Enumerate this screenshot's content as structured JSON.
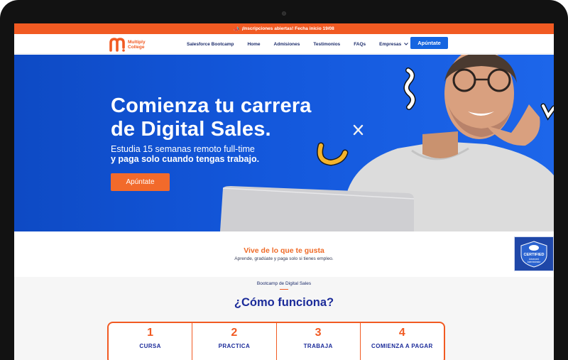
{
  "promo": {
    "text": "¡Inscripciones abiertas! Fecha inicio 19/08"
  },
  "brand": {
    "line1": "Multiply",
    "line2": "College",
    "color_orange": "#f15a22",
    "color_blue": "#1565e0",
    "color_navy": "#1c2c6b"
  },
  "nav": {
    "items": [
      {
        "label": "Salesforce Bootcamp"
      },
      {
        "label": "Home"
      },
      {
        "label": "Admisiones"
      },
      {
        "label": "Testimonios"
      },
      {
        "label": "FAQs"
      },
      {
        "label": "Empresas"
      }
    ],
    "cta": "Apúntate"
  },
  "hero": {
    "title_line1": "Comienza tu carrera",
    "title_line2": "de Digital Sales.",
    "subtitle_line1": "Estudia 15 semanas remoto full-time",
    "subtitle_line2": "y paga solo cuando tengas trabajo.",
    "button": "Apúntate"
  },
  "tagline": {
    "title": "Vive de lo que te gusta",
    "subtitle": "Aprende, gradúate y paga solo si tienes empleo."
  },
  "badge": {
    "title": "CERTIFIED",
    "line1": "Advanced",
    "line2": "Administrator"
  },
  "how": {
    "kicker": "Bootcamp de Digital Sales",
    "title": "¿Cómo funciona?",
    "steps": [
      {
        "number": "1",
        "label": "CURSA"
      },
      {
        "number": "2",
        "label": "PRACTICA"
      },
      {
        "number": "3",
        "label": "TRABAJA"
      },
      {
        "number": "4",
        "label": "COMIENZA A PAGAR"
      }
    ]
  }
}
